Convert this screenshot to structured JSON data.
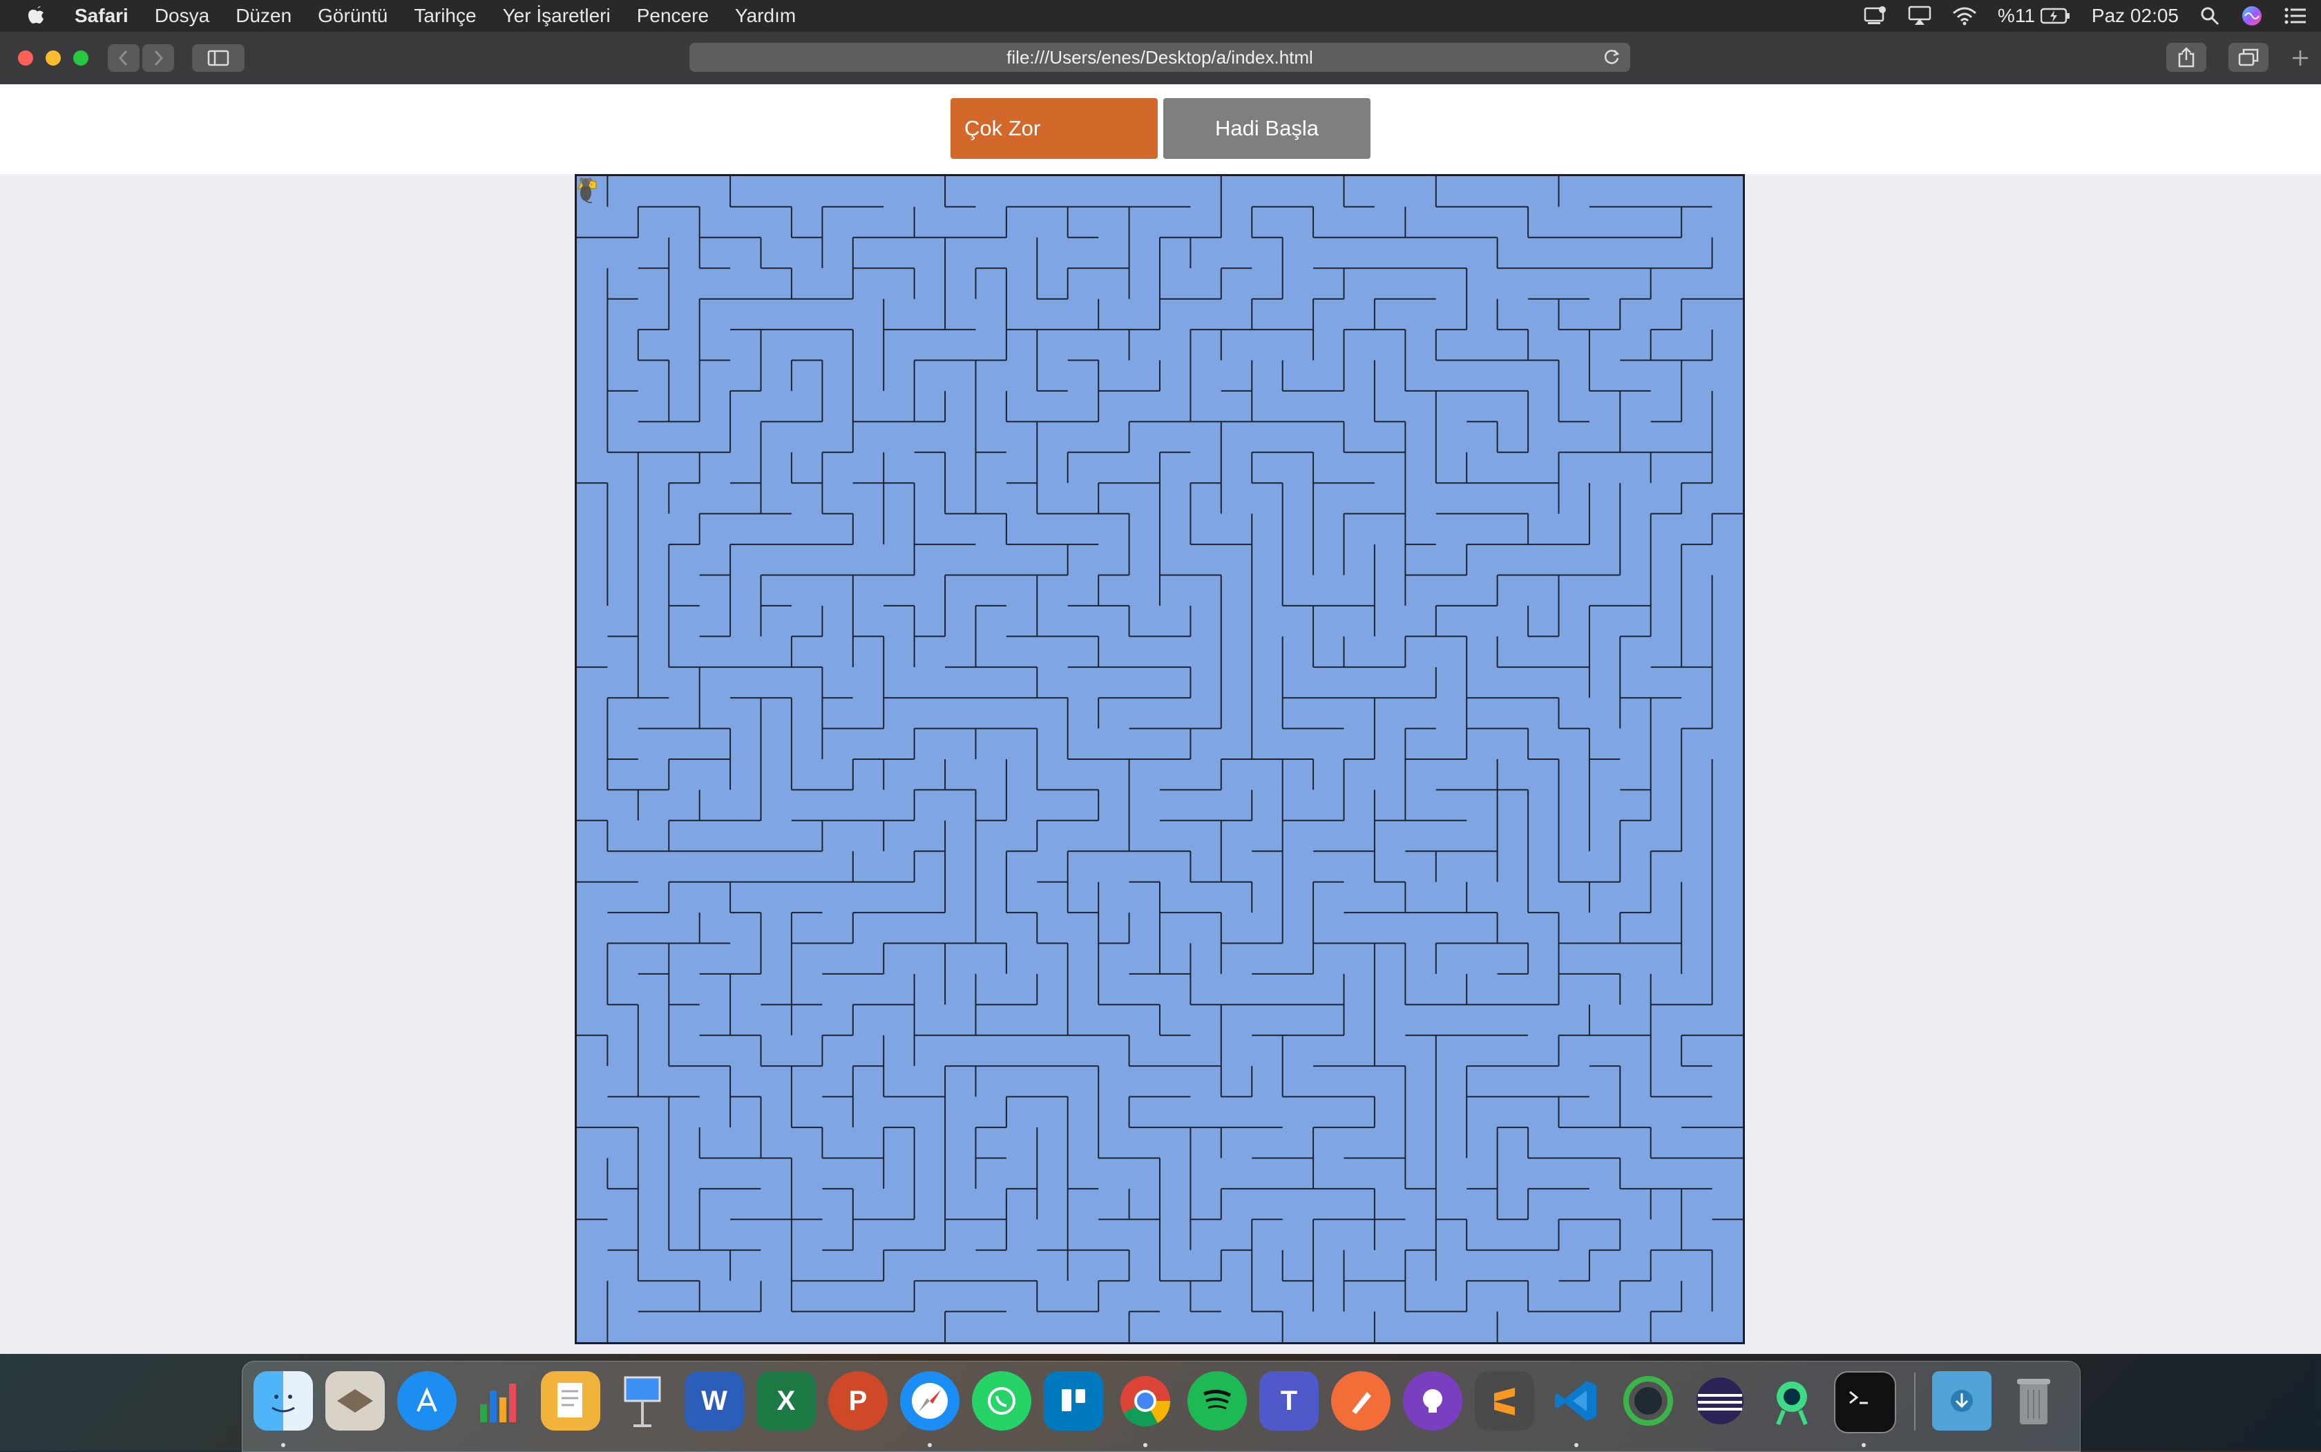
{
  "menubar": {
    "app": "Safari",
    "items": [
      "Dosya",
      "Düzen",
      "Görüntü",
      "Tarihçe",
      "Yer İşaretleri",
      "Pencere",
      "Yardım"
    ],
    "battery": "%11",
    "clock": "Paz 02:05"
  },
  "browser": {
    "url": "file:///Users/enes/Desktop/a/index.html"
  },
  "game": {
    "difficulty_label": "Çok Zor",
    "start_label": "Hadi Başla"
  },
  "colors": {
    "maze_floor": "#7fa6e2",
    "difficulty_button": "#d2692a",
    "start_button": "#7f7f7f"
  },
  "dock": {
    "apps": [
      "finder",
      "mail",
      "app-store",
      "numbers",
      "pages",
      "keynote",
      "word",
      "excel",
      "powerpoint",
      "safari",
      "whatsapp",
      "trello",
      "chrome",
      "spotify",
      "teams",
      "paw",
      "github-desktop",
      "sublime-text",
      "vscode",
      "android-studio",
      "eclipse",
      "android-studio-2",
      "terminal",
      "downloads-folder",
      "trash"
    ]
  }
}
